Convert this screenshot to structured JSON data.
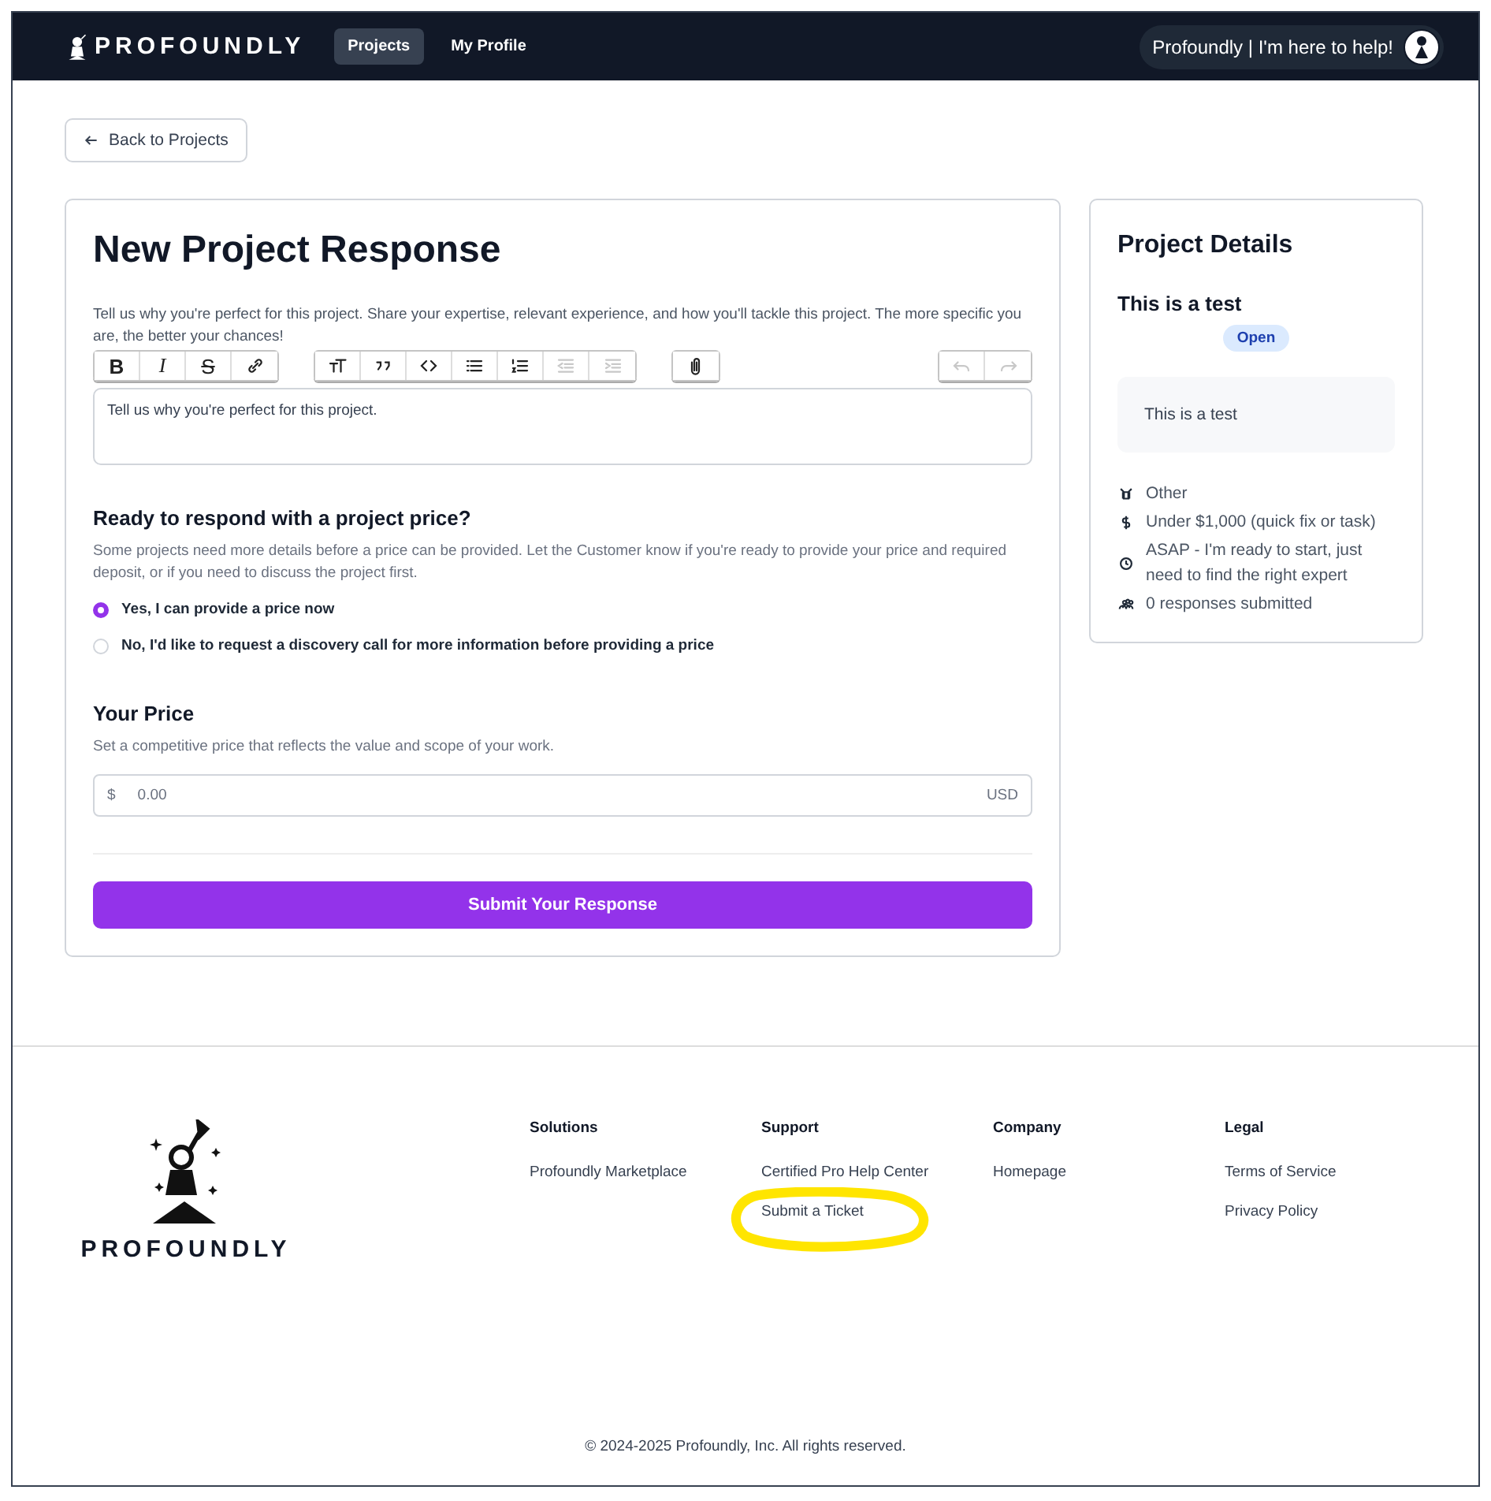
{
  "header": {
    "logo": "PROFOUNDLY",
    "nav": [
      {
        "label": "Projects",
        "selected": true
      },
      {
        "label": "My Profile",
        "selected": false
      }
    ],
    "help_button": "Profoundly | I'm here to help!"
  },
  "back_button": "Back to Projects",
  "form": {
    "title": "New Project Response",
    "intro": "Tell us why you're perfect for this project. Share your expertise, relevant experience, and how you'll tackle this project. The more specific you are, the better your chances!",
    "toolbar": [
      [
        {
          "kind": "bold",
          "label": "B",
          "disabled": false
        },
        {
          "kind": "italic",
          "label": "I",
          "disabled": false
        },
        {
          "kind": "strike",
          "label": "S",
          "disabled": false
        },
        {
          "kind": "link",
          "disabled": false
        }
      ],
      [
        {
          "kind": "heading",
          "disabled": false
        },
        {
          "kind": "quote",
          "disabled": false
        },
        {
          "kind": "code",
          "disabled": false
        },
        {
          "kind": "bullets",
          "disabled": false
        },
        {
          "kind": "numbers",
          "disabled": false
        },
        {
          "kind": "outdent",
          "disabled": true
        },
        {
          "kind": "indent",
          "disabled": true
        }
      ],
      [
        {
          "kind": "attach",
          "disabled": false
        }
      ],
      [
        {
          "kind": "undo",
          "disabled": true
        },
        {
          "kind": "redo",
          "disabled": true
        }
      ]
    ],
    "editor_placeholder": "Tell us why you're perfect for this project.",
    "price_question": {
      "title": "Ready to respond with a project price?",
      "description": "Some projects need more details before a price can be provided. Let the Customer know if you're ready to provide your price and required deposit, or if you need to discuss the project first.",
      "options": [
        {
          "label": "Yes, I can provide a price now",
          "selected": true
        },
        {
          "label": "No, I'd like to request a discovery call for more information before providing a price",
          "selected": false
        }
      ]
    },
    "price": {
      "title": "Your Price",
      "description": "Set a competitive price that reflects the value and scope of your work.",
      "currency_symbol": "$",
      "placeholder": "0.00",
      "currency": "USD"
    },
    "submit": "Submit Your Response"
  },
  "details": {
    "title": "Project Details",
    "project_title": "This is a test",
    "status": "Open",
    "description": "This is a test",
    "facts": [
      {
        "kind": "category",
        "text": "Other"
      },
      {
        "kind": "budget",
        "text": "Under $1,000 (quick fix or task)"
      },
      {
        "kind": "timeline",
        "text": "ASAP - I'm ready to start, just need to find the right expert"
      },
      {
        "kind": "responses",
        "text": "0 responses submitted"
      }
    ]
  },
  "footer": {
    "logo": "PROFOUNDLY",
    "columns": [
      {
        "heading": "Solutions",
        "links": [
          "Profoundly Marketplace"
        ]
      },
      {
        "heading": "Support",
        "links": [
          "Certified Pro Help Center",
          "Submit a Ticket"
        ]
      },
      {
        "heading": "Company",
        "links": [
          "Homepage"
        ]
      },
      {
        "heading": "Legal",
        "links": [
          "Terms of Service",
          "Privacy Policy"
        ]
      }
    ],
    "copyright": "© 2024-2025 Profoundly, Inc. All rights reserved."
  }
}
